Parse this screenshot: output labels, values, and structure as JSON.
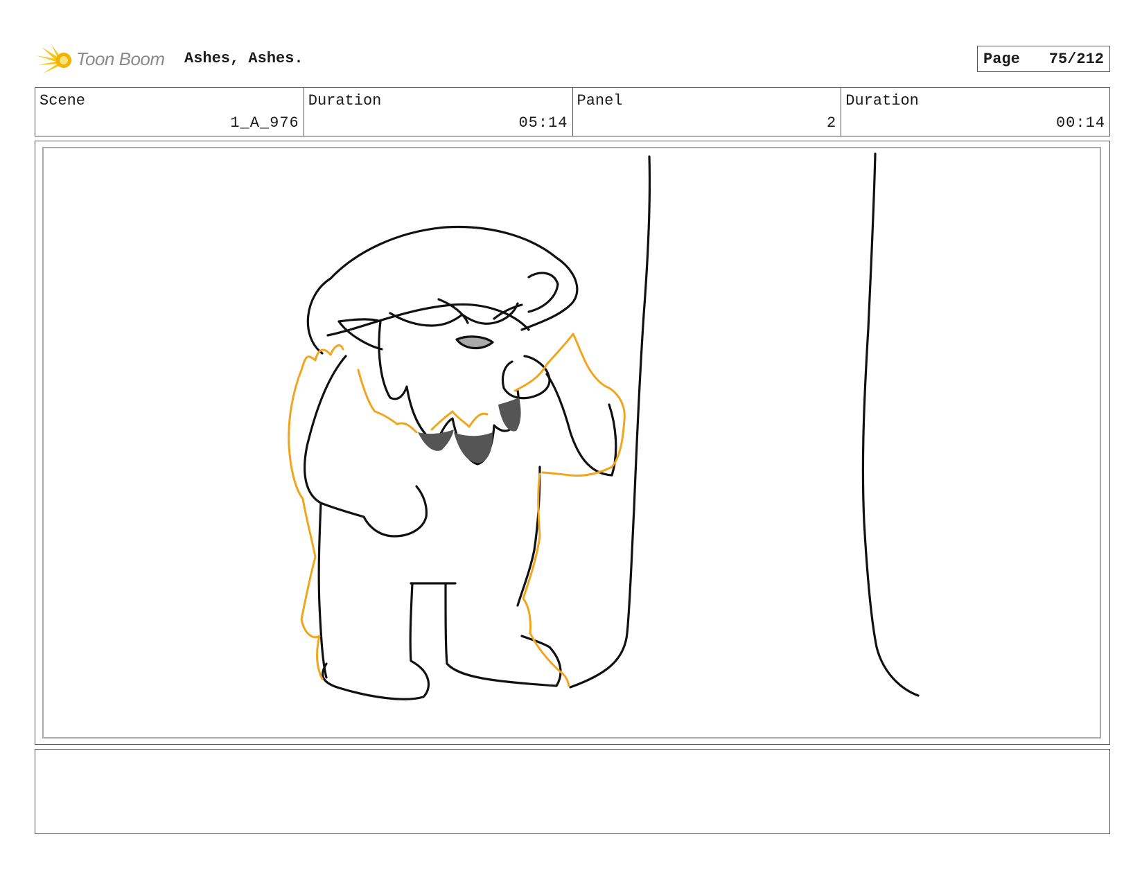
{
  "header": {
    "logo_text": "Toon Boom",
    "project_title": "Ashes, Ashes.",
    "page_label": "Page",
    "page_number": "75/212"
  },
  "info": {
    "scene_label": "Scene",
    "scene_value": "1_A_976",
    "scene_duration_label": "Duration",
    "scene_duration_value": "05:14",
    "panel_label": "Panel",
    "panel_value": "2",
    "panel_duration_label": "Duration",
    "panel_duration_value": "00:14"
  },
  "drawing": {
    "subject": "gnome-with-mushroom-hat-and-flames",
    "line_color": "#111111",
    "flame_color": "#f2a51c",
    "shadow_color": "#555555"
  },
  "notes": {
    "text": ""
  }
}
